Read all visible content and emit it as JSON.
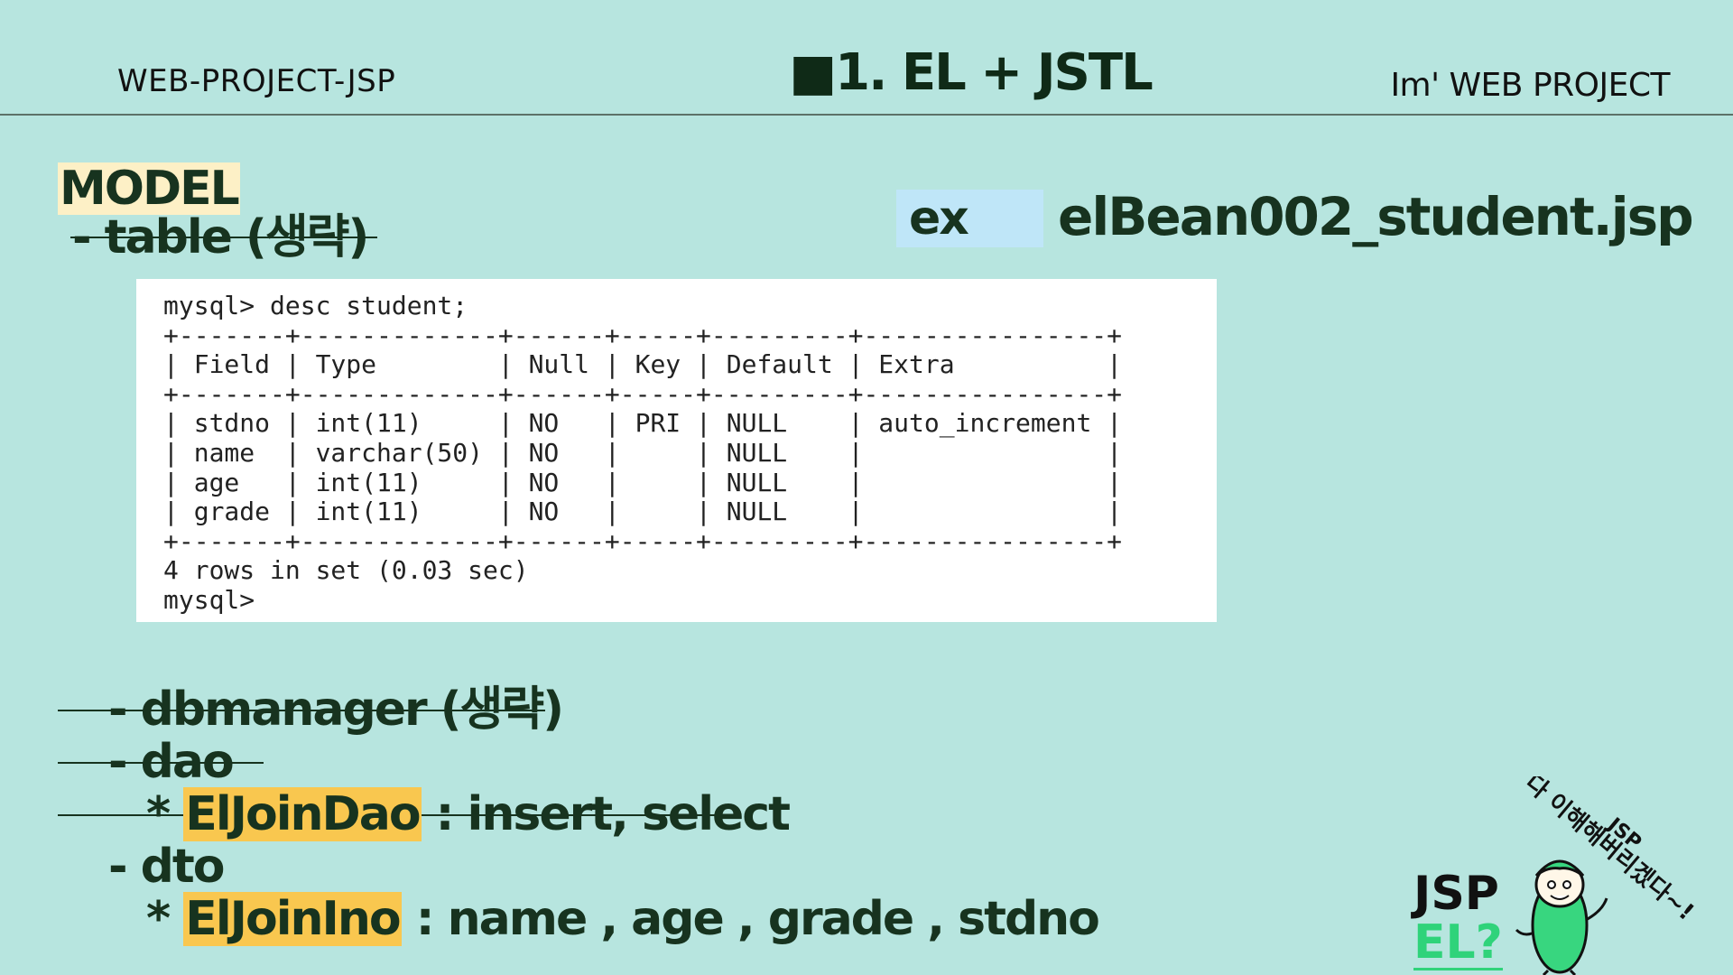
{
  "header": {
    "left_label": "WEB-PROJECT-JSP",
    "title": "■1. EL + JSTL",
    "right_label": "Im'  WEB PROJECT"
  },
  "model": {
    "heading": "MODEL",
    "table_line": "- table (생략)"
  },
  "example": {
    "label": "ex",
    "filename": "elBean002_student.jsp"
  },
  "terminal": {
    "command": "mysql> desc student;",
    "border": "+-------+-------------+------+-----+---------+----------------+",
    "headers": [
      "Field",
      "Type",
      "Null",
      "Key",
      "Default",
      "Extra"
    ],
    "rows": [
      [
        "stdno",
        "int(11)",
        "NO",
        "PRI",
        "NULL",
        "auto_increment"
      ],
      [
        "name",
        "varchar(50)",
        "NO",
        "",
        "NULL",
        ""
      ],
      [
        "age",
        "int(11)",
        "NO",
        "",
        "NULL",
        ""
      ],
      [
        "grade",
        "int(11)",
        "NO",
        "",
        "NULL",
        ""
      ]
    ],
    "summary": "4 rows in set (0.03 sec)",
    "prompt": "mysql>"
  },
  "list": {
    "dbmanager": "-  dbmanager  (생략)",
    "dao": "-  dao",
    "eldao_prefix": "* ",
    "eldao_name": "ElJoinDao",
    "eldao_suffix": " : insert, select",
    "dto": "-  dto",
    "elino_prefix": "*  ",
    "elino_name": "ElJoinIno",
    "elino_suffix": " : name , age , grade , stdno"
  },
  "mascot": {
    "jsp": "JSP",
    "el": "EL?",
    "speech_tag": "JSP",
    "speech_text": "다 이해해버리겠다~!"
  },
  "colors": {
    "background": "#b7e5df",
    "highlight": "#f9c74f",
    "model_bg": "#fdf0c6",
    "ex_bg": "#bfe6f8",
    "accent_green": "#2fd37a"
  }
}
